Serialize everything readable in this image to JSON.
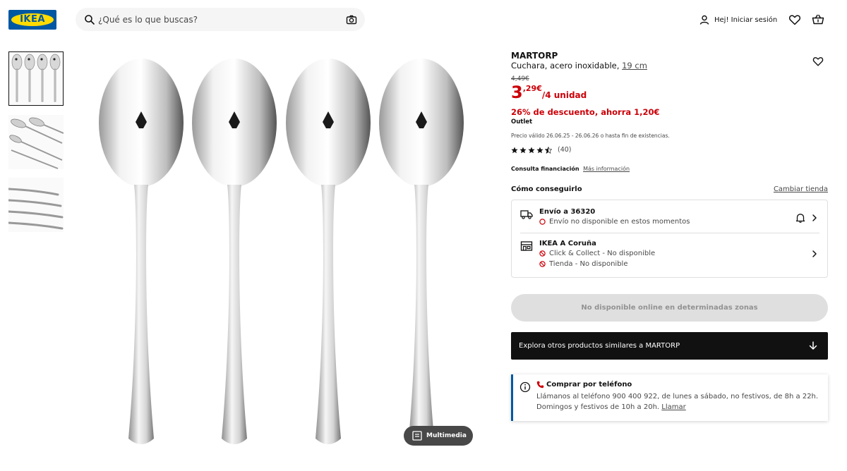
{
  "header": {
    "logo_text": "IKEA",
    "search_placeholder": "¿Qué es lo que buscas?",
    "login_label": "Hej! Iniciar sesión",
    "brand_blue": "#0058a3",
    "brand_yellow": "#ffdb00"
  },
  "gallery": {
    "thumbnails": [
      "thumb-four-spoons",
      "thumb-spoons-angled",
      "thumb-spoon-handles"
    ],
    "selected_index": 0,
    "multimedia_label": "Multimedia"
  },
  "product": {
    "name": "MARTORP",
    "description": "Cuchara, acero inoxidable,",
    "size": "19 cm",
    "old_price": "4,49€",
    "price_int": "3",
    "price_dec": ",29€",
    "price_unit": "/4 unidad",
    "discount": "26% de descuento, ahorra 1,20€",
    "badge": "Outlet",
    "validity": "Precio válido 26.06.25 - 26.06.26 o hasta fin de existencias.",
    "rating_value": 4.5,
    "rating_count": "(40)",
    "financing_label": "Consulta financiación",
    "financing_link": "Más información",
    "price_color": "#cc0008"
  },
  "availability": {
    "title": "Cómo conseguirlo",
    "change_store": "Cambiar tienda",
    "delivery": {
      "title": "Envío a 36320",
      "status": "Envío no disponible en estos momentos"
    },
    "store": {
      "title": "IKEA A Coruña",
      "click_collect": "Click & Collect - No disponible",
      "in_store": "Tienda - No disponible"
    }
  },
  "actions": {
    "unavailable_button": "No disponible online en determinadas zonas",
    "explore_button": "Explora otros productos similares a MARTORP"
  },
  "phone": {
    "title": "Comprar por teléfono",
    "text": "Llámanos al teléfono 900 400 922, de lunes a sábado, no festivos, de 8h a 22h. Domingos y festivos de 10h a 20h.",
    "link": "Llamar"
  }
}
